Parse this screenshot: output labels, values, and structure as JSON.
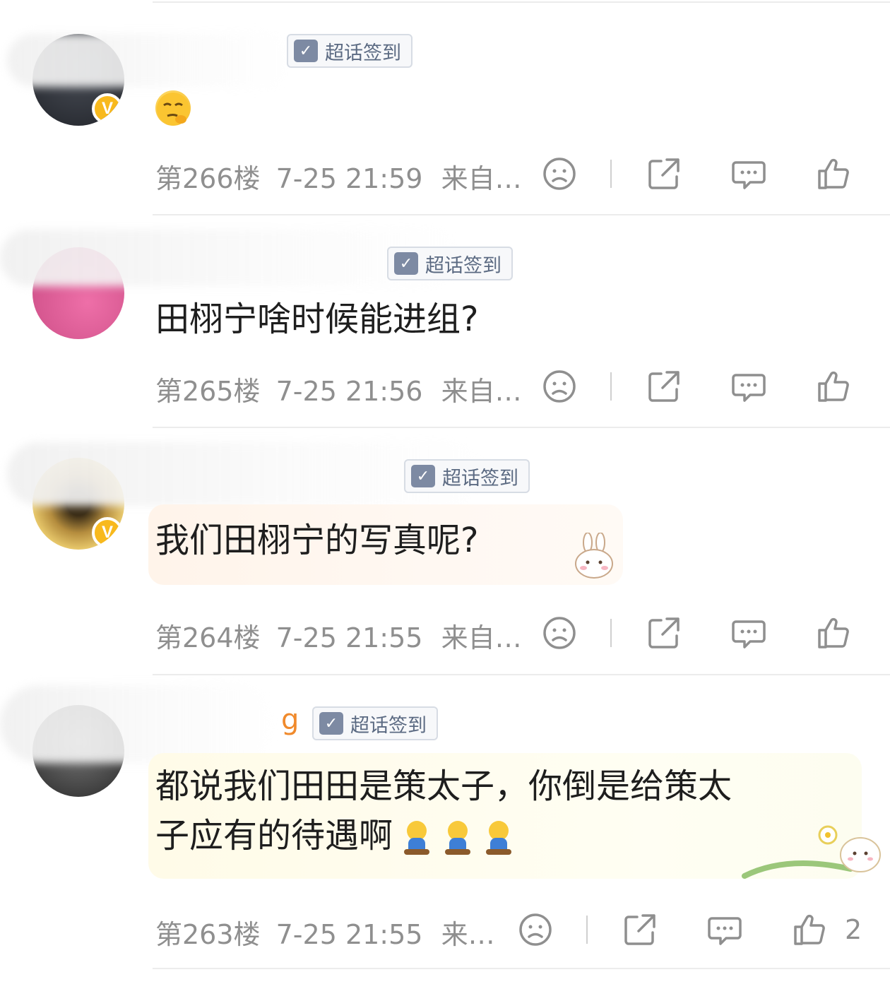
{
  "badge_label": "超话签到",
  "badge_icon": "check-calendar-icon",
  "colors": {
    "username": "#f08a2c",
    "meta_text": "#8f8f8f",
    "vip_badge": "#f8b91d"
  },
  "comments": [
    {
      "username": "",
      "text": "",
      "emoji": "thinking-face-emoji",
      "floor": "第266楼",
      "time": "7-25 21:59",
      "source": "来自…",
      "likes": ""
    },
    {
      "username": "",
      "text": "田栩宁啥时候能进组?",
      "floor": "第265楼",
      "time": "7-25 21:56",
      "source": "来自…",
      "likes": ""
    },
    {
      "username": "",
      "text": "我们田栩宁的写真呢?",
      "floor": "第264楼",
      "time": "7-25 21:55",
      "source": "来自…",
      "likes": ""
    },
    {
      "username": "g",
      "text_line1": "都说我们田田是策太子，你倒是给策太",
      "text_line2": "子应有的待遇啊",
      "floor": "第263楼",
      "time": "7-25 21:55",
      "source": "来…",
      "likes": "2"
    }
  ]
}
